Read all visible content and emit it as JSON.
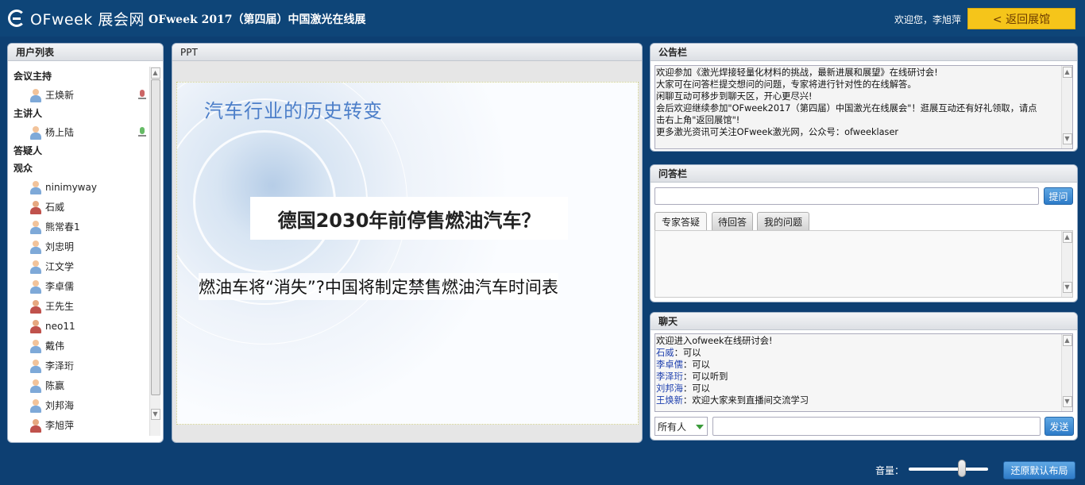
{
  "header": {
    "logo_text": "OFweek 展会网",
    "event_title": "OFweek 2017（第四届）中国激光在线展",
    "welcome": "欢迎您，李旭萍",
    "back_button": "< 返回展馆"
  },
  "user_list": {
    "title": "用户列表",
    "groups": {
      "host": "会议主持",
      "speaker": "主讲人",
      "qa": "答疑人",
      "audience": "观众"
    },
    "host_name": "王焕新",
    "speaker_name": "杨上陆",
    "audience": [
      "ninimyway",
      "石威",
      "熊常春1",
      "刘忠明",
      "江文学",
      "李卓儒",
      "王先生",
      "neo11",
      "戴伟",
      "李泽珩",
      "陈赢",
      "刘邦海",
      "李旭萍"
    ]
  },
  "ppt": {
    "title": "PPT",
    "slide_title": "汽车行业的历史转变",
    "slide_question": "德国2030年前停售燃油汽车？",
    "slide_subtitle": "燃油车将“消失”?中国将制定禁售燃油汽车时间表"
  },
  "notice": {
    "title": "公告栏",
    "lines": [
      "欢迎参加《激光焊接轻量化材料的挑战，最新进展和展望》在线研讨会!",
      "大家可在问答栏提交想问的问题，专家将进行针对性的在线解答。",
      "闲聊互动可移步到聊天区，开心更尽兴!",
      "会后欢迎继续参加\"OFweek2017（第四届）中国激光在线展会\"！逛展互动还有好礼领取，请点",
      "击右上角\"返回展馆\"!",
      "更多激光资讯可关注OFweek激光网，公众号：ofweeklaser"
    ]
  },
  "qa": {
    "title": "问答栏",
    "input_value": "",
    "submit_button": "提问",
    "tabs": [
      "专家答疑",
      "待回答",
      "我的问题"
    ]
  },
  "chat": {
    "title": "聊天",
    "welcome_line": "欢迎进入ofweek在线研讨会!",
    "messages": [
      {
        "name": "石威",
        "text": "可以"
      },
      {
        "name": "李卓儒",
        "text": "可以"
      },
      {
        "name": "李泽珩",
        "text": "可以听到"
      },
      {
        "name": "刘邦海",
        "text": "可以"
      },
      {
        "name": "王焕新",
        "text": "欢迎大家来到直播间交流学习"
      }
    ],
    "recipient_selected": "所有人",
    "input_value": "",
    "send_button": "发送",
    "separator": "："
  },
  "footer": {
    "volume_label": "音量：",
    "volume_level": 0.67,
    "reset_button": "还原默认布局"
  },
  "colors": {
    "background": "#0d3f72",
    "back_button": "#f5c51a",
    "blue_button": "#2d7bc8",
    "slide_title": "#4d7fc9",
    "chat_name": "#1d3fae"
  }
}
